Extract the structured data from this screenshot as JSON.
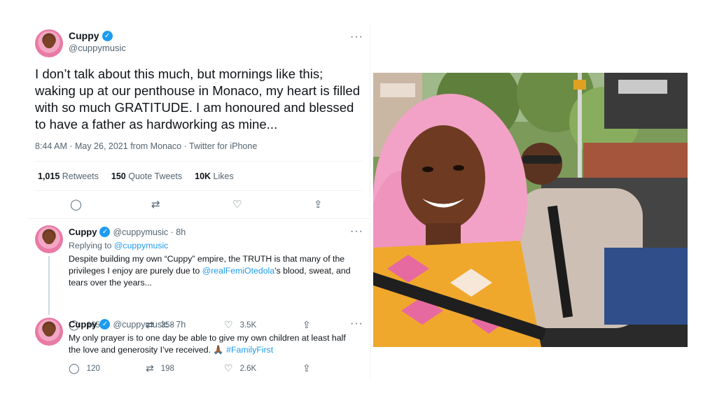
{
  "main_tweet": {
    "name": "Cuppy",
    "handle": "@cuppymusic",
    "text": "I don’t talk about this much, but mornings like this; waking up at our penthouse in Monaco, my heart is filled with so much GRATITUDE. I am honoured and blessed to have a father as hardworking as mine...",
    "timestamp": "8:44 AM · May 26, 2021 from Monaco · Twitter for iPhone",
    "stats": [
      {
        "count": "1,015",
        "label": "Retweets"
      },
      {
        "count": "150",
        "label": "Quote Tweets"
      },
      {
        "count": "10K",
        "label": "Likes"
      }
    ]
  },
  "replies": [
    {
      "name": "Cuppy",
      "handle_time": "@cuppymusic · 8h",
      "replying_prefix": "Replying to",
      "replying_handle": "@cuppymusic",
      "text_before": "Despite building my own “Cuppy” empire, the TRUTH is that many of the privileges I enjoy are purely due to",
      "mention": "@realFemiOtedola",
      "text_after": "’s blood, sweat, and tears over the years...",
      "reply_count": "165",
      "retweet_count": "358",
      "like_count": "3.5K"
    },
    {
      "name": "Cuppy",
      "handle_time": "@cuppymusic · 7h",
      "text_before": "My only prayer is to one day be able to give my own children at least half the love and generosity I’ve received. 🙏🏾",
      "hashtag": "#FamilyFirst",
      "reply_count": "120",
      "retweet_count": "198",
      "like_count": "2.6K"
    }
  ],
  "icons": {
    "verified": "✓",
    "more": "···",
    "reply": "◯",
    "retweet": "⇄",
    "like": "♡",
    "share": "⇪"
  },
  "colors": {
    "accent": "#1d9bf0",
    "text": "#0f1419",
    "secondary": "#536471"
  }
}
